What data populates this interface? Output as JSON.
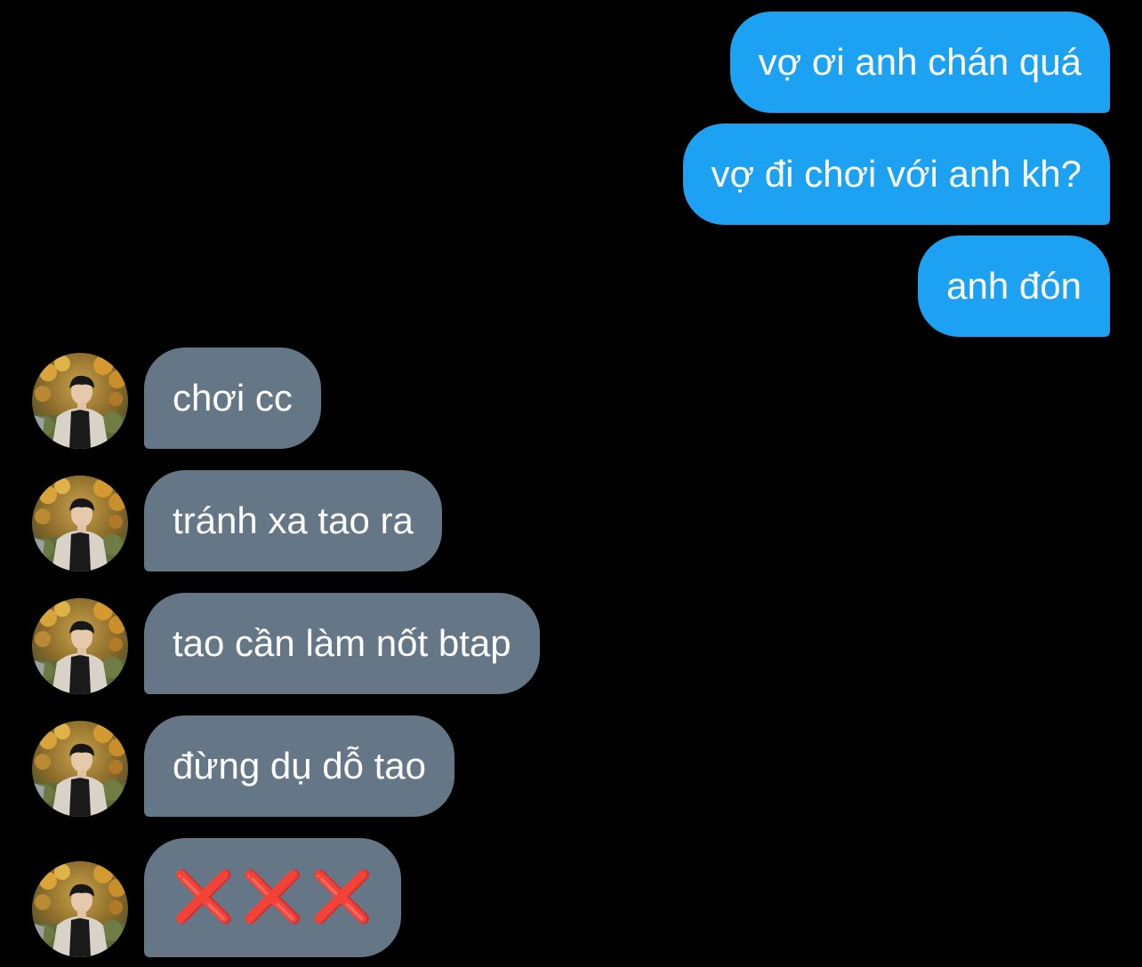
{
  "conversation": {
    "outgoing": [
      {
        "text": "vợ ơi anh chán quá"
      },
      {
        "text": "vợ đi chơi với anh kh?"
      },
      {
        "text": "anh đón"
      }
    ],
    "incoming": [
      {
        "text": "chơi cc"
      },
      {
        "text": "tránh xa tao ra"
      },
      {
        "text": "tao cần làm nốt btap"
      },
      {
        "text": "đừng dụ dỗ tao"
      },
      {
        "emoji": [
          "❌",
          "❌",
          "❌"
        ]
      }
    ]
  },
  "colors": {
    "background": "#000000",
    "outgoing_bubble": "#1da1f2",
    "incoming_bubble": "#657786",
    "emoji_cross": "#e8131f"
  },
  "icons": {
    "avatar": "profile-photo-avatar",
    "cross": "cross-mark-emoji"
  }
}
